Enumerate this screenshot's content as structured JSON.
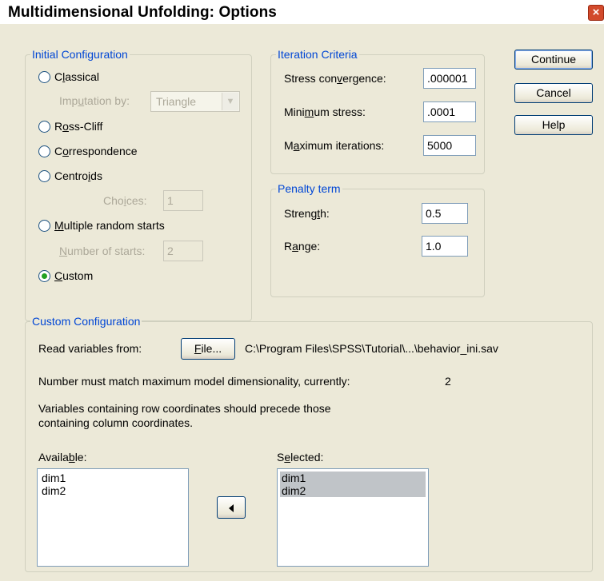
{
  "window": {
    "title": "Multidimensional Unfolding: Options",
    "close_glyph": "×"
  },
  "initial_config": {
    "legend": "Initial Configuration",
    "classical": {
      "pre": "C",
      "u": "l",
      "post": "assical",
      "checked": false
    },
    "imputation": {
      "pre": "Imp",
      "u": "u",
      "post": "tation by:",
      "value": "Triangle"
    },
    "ross_cliff": {
      "pre": "R",
      "u": "o",
      "post": "ss-Cliff",
      "checked": false
    },
    "correspondence": {
      "pre": "C",
      "u": "o",
      "post": "rrespondence",
      "checked": false
    },
    "centroids": {
      "pre": "Centro",
      "u": "i",
      "post": "ds",
      "checked": false
    },
    "choices": {
      "pre": "Cho",
      "u": "i",
      "post": "ces:",
      "value": "1"
    },
    "multiple_random": {
      "pre": "",
      "u": "M",
      "post": "ultiple random starts",
      "checked": false
    },
    "num_starts": {
      "pre": "",
      "u": "N",
      "post": "umber of starts:",
      "value": "2"
    },
    "custom": {
      "pre": "",
      "u": "C",
      "post": "ustom",
      "checked": true
    }
  },
  "iteration": {
    "legend": "Iteration Criteria",
    "stress_convergence": {
      "pre": "Stress con",
      "u": "v",
      "post": "ergence:",
      "value": ".000001"
    },
    "minimum_stress": {
      "pre": "Mini",
      "u": "m",
      "post": "um stress:",
      "value": ".0001"
    },
    "maximum_iterations": {
      "pre": "M",
      "u": "a",
      "post": "ximum iterations:",
      "value": "5000"
    }
  },
  "penalty": {
    "legend": "Penalty term",
    "strength": {
      "pre": "Streng",
      "u": "t",
      "post": "h:",
      "value": "0.5"
    },
    "range": {
      "pre": "R",
      "u": "a",
      "post": "nge:",
      "value": "1.0"
    }
  },
  "buttons": {
    "continue": "Continue",
    "cancel": "Cancel",
    "help": "Help"
  },
  "custom_config": {
    "legend": "Custom Configuration",
    "read_label": "Read variables from:",
    "file_btn": {
      "pre": "",
      "u": "F",
      "post": "ile..."
    },
    "file_path": "C:\\Program Files\\SPSS\\Tutorial\\...\\behavior_ini.sav",
    "dim_note": "Number must match maximum model dimensionality, currently:",
    "dim_value": "2",
    "order_note_1": "Variables containing row coordinates should precede those",
    "order_note_2": "containing column coordinates.",
    "available_label": {
      "pre": "Availa",
      "u": "b",
      "post": "le:"
    },
    "available_items": [
      "dim1",
      "dim2"
    ],
    "selected_label": {
      "pre": "S",
      "u": "e",
      "post": "lected:"
    },
    "selected_items": [
      "dim1",
      "dim2"
    ]
  },
  "colors": {
    "legend": "#0046d5",
    "face": "#ece9d8",
    "disabled": "#aca899",
    "radio_dot": "#21a121"
  }
}
